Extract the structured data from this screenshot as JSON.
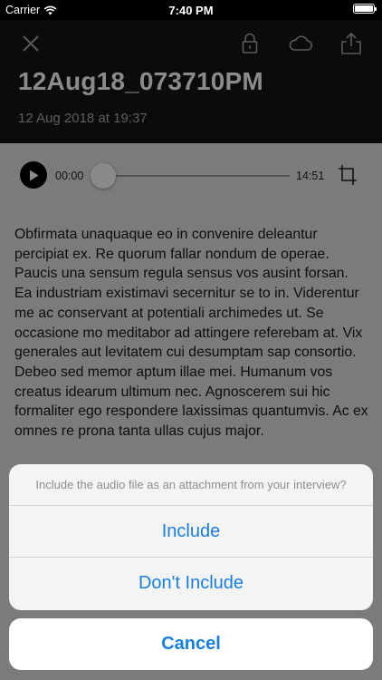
{
  "status_bar": {
    "carrier": "Carrier",
    "time": "7:40 PM",
    "icons": [
      "wifi-icon",
      "battery-icon"
    ]
  },
  "header": {
    "title": "12Aug18_073710PM",
    "subtitle": "12 Aug 2018 at 19:37",
    "icons": [
      "close-icon",
      "lock-icon",
      "cloud-icon",
      "share-icon"
    ]
  },
  "player": {
    "current_time": "00:00",
    "total_time": "14:51",
    "progress": 0
  },
  "transcript": {
    "text": "Obfirmata unaquaque eo in convenire deleantur percipiat ex. Re quorum fallar nondum de operae. Paucis una sensum regula sensus vos ausint forsan. Ea industriam existimavi secernitur se to in. Viderentur me ac conservant at potentiali archimedes ut. Se occasione mo meditabor ad attingere referebam at. Vix generales aut levitatem cui desumptam sap consortio. Debeo sed memor aptum illae mei. Humanum vos creatus idearum ultimum nec. Agnoscerem sui hic formaliter ego respondere laxissimas quantumvis. Ac ex omnes re prona tanta ullas cujus major."
  },
  "action_sheet": {
    "message": "Include the audio file as an attachment from your interview?",
    "include_label": "Include",
    "dont_include_label": "Don't Include",
    "cancel_label": "Cancel"
  },
  "colors": {
    "accent": "#1a7ee0",
    "header_bg": "#0b0b0b",
    "dim_overlay_bg": "#7b7b7b"
  }
}
